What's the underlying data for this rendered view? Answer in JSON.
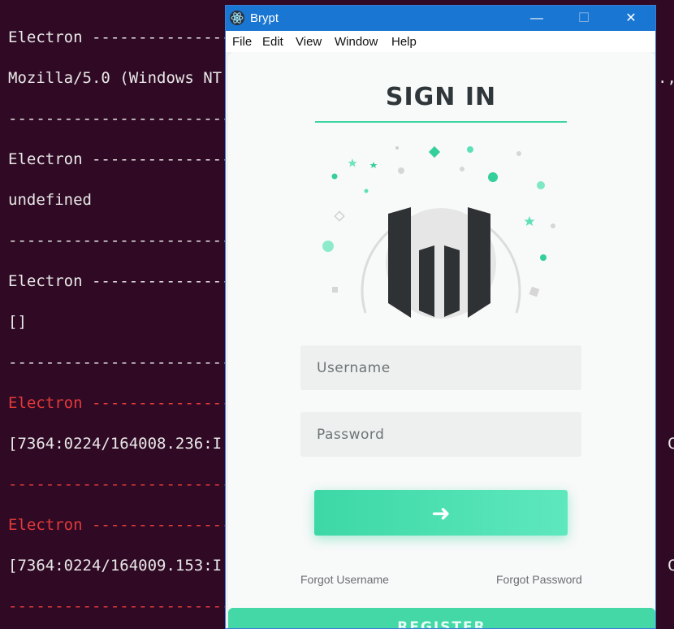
{
  "terminal": {
    "lines": [
      {
        "text": "Electron ---------------",
        "red": false
      },
      {
        "text": "Mozilla/5.0 (Windows NT",
        "red": false
      },
      {
        "text": "------------------------",
        "red": false
      },
      {
        "text": "Electron ---------------",
        "red": false
      },
      {
        "text": "undefined",
        "red": false
      },
      {
        "text": "------------------------",
        "red": false
      },
      {
        "text": "Electron ---------------",
        "red": false
      },
      {
        "text": "[]",
        "red": false
      },
      {
        "text": "------------------------",
        "red": false
      },
      {
        "text": "Electron ---------------",
        "red": true
      },
      {
        "text": "[7364:0224/164008.236:I",
        "red": false
      },
      {
        "text": "------------------------",
        "red": true
      },
      {
        "text": "Electron ---------------",
        "red": true
      },
      {
        "text": "[7364:0224/164009.153:I",
        "red": false
      },
      {
        "text": "------------------------",
        "red": true
      }
    ],
    "right_fragments": {
      "line2": ".,",
      "line11": "C",
      "line14": "C"
    }
  },
  "window": {
    "title": "Brypt",
    "minimize": "—",
    "maximize": "☐",
    "close": "✕"
  },
  "menu": [
    "File",
    "Edit",
    "View",
    "Window",
    "Help"
  ],
  "signin": {
    "title": "SIGN IN",
    "username_placeholder": "Username",
    "password_placeholder": "Password",
    "submit_icon": "➜",
    "forgot_username": "Forgot Username",
    "forgot_password": "Forgot Password",
    "register": "REGISTER"
  },
  "colors": {
    "accent": "#3dd6a3",
    "titlebar": "#1976d2",
    "terminal_bg": "#300a24",
    "terminal_red": "#e23a3a"
  }
}
